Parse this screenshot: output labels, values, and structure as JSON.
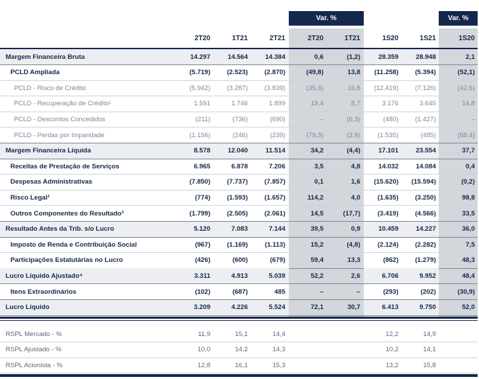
{
  "var_header": "Var. %",
  "var_header_2": "Var. %",
  "columns": [
    "2T20",
    "1T21",
    "2T21",
    "2T20",
    "1T21",
    "1S20",
    "1S21",
    "1S20"
  ],
  "rows": [
    {
      "label": "Margem Financeira Bruta",
      "style": "bold",
      "values": [
        "14.297",
        "14.564",
        "14.384",
        "0,6",
        "(1,2)",
        "28.359",
        "28.948",
        "2,1"
      ]
    },
    {
      "label": "PCLD Ampliada",
      "style": "mid",
      "values": [
        "(5.719)",
        "(2.523)",
        "(2.870)",
        "(49,8)",
        "13,8",
        "(11.258)",
        "(5.394)",
        "(52,1)"
      ]
    },
    {
      "label": "PCLD - Risco de Crédito",
      "style": "light",
      "values": [
        "(5.942)",
        "(3.287)",
        "(3.839)",
        "(35,4)",
        "16,8",
        "(12.419)",
        "(7.126)",
        "(42,6)"
      ]
    },
    {
      "label": "PCLD - Recuperação de Crédito¹",
      "style": "light",
      "values": [
        "1.591",
        "1.746",
        "1.899",
        "19,4",
        "8,7",
        "3.176",
        "3.645",
        "14,8"
      ]
    },
    {
      "label": "PCLD - Descontos Concedidos",
      "style": "light",
      "values": [
        "(211)",
        "(736)",
        "(690)",
        "–",
        "(6,3)",
        "(480)",
        "(1.427)",
        "–"
      ]
    },
    {
      "label": "PCLD - Perdas por Imparidade",
      "style": "light",
      "values": [
        "(1.156)",
        "(246)",
        "(239)",
        "(79,3)",
        "(2,8)",
        "(1.535)",
        "(485)",
        "(68,4)"
      ]
    },
    {
      "label": "Margem Financeira Líquida",
      "style": "bold",
      "values": [
        "8.578",
        "12.040",
        "11.514",
        "34,2",
        "(4,4)",
        "17.101",
        "23.554",
        "37,7"
      ]
    },
    {
      "label": "Receitas de Prestação de Serviços",
      "style": "mid",
      "values": [
        "6.965",
        "6.878",
        "7.206",
        "3,5",
        "4,8",
        "14.032",
        "14.084",
        "0,4"
      ]
    },
    {
      "label": "Despesas Administrativas",
      "style": "mid",
      "values": [
        "(7.850)",
        "(7.737)",
        "(7.857)",
        "0,1",
        "1,6",
        "(15.620)",
        "(15.594)",
        "(0,2)"
      ]
    },
    {
      "label": "Risco Legal²",
      "style": "mid",
      "values": [
        "(774)",
        "(1.593)",
        "(1.657)",
        "114,2",
        "4,0",
        "(1.635)",
        "(3.250)",
        "98,8"
      ]
    },
    {
      "label": "Outros Componentes do Resultado³",
      "style": "mid",
      "values": [
        "(1.799)",
        "(2.505)",
        "(2.061)",
        "14,5",
        "(17,7)",
        "(3.419)",
        "(4.566)",
        "33,5"
      ]
    },
    {
      "label": "Resultado Antes da Trib. s/o Lucro",
      "style": "bold",
      "values": [
        "5.120",
        "7.083",
        "7.144",
        "39,5",
        "0,9",
        "10.459",
        "14.227",
        "36,0"
      ]
    },
    {
      "label": "Imposto de Renda e Contribuição Social",
      "style": "mid",
      "values": [
        "(967)",
        "(1.169)",
        "(1.113)",
        "15,2",
        "(4,8)",
        "(2.124)",
        "(2.282)",
        "7,5"
      ]
    },
    {
      "label": "Participações Estatutárias no Lucro",
      "style": "mid",
      "values": [
        "(426)",
        "(600)",
        "(679)",
        "59,4",
        "13,3",
        "(862)",
        "(1.279)",
        "48,3"
      ]
    },
    {
      "label": "Lucro Líquido Ajustado⁴",
      "style": "bold",
      "values": [
        "3.311",
        "4.913",
        "5.039",
        "52,2",
        "2,6",
        "6.706",
        "9.952",
        "48,4"
      ]
    },
    {
      "label": "Itens Extraordinários",
      "style": "mid",
      "values": [
        "(102)",
        "(687)",
        "485",
        "–",
        "–",
        "(293)",
        "(202)",
        "(30,9)"
      ]
    },
    {
      "label": "Lucro Líquido",
      "style": "bold",
      "values": [
        "3.209",
        "4.226",
        "5.524",
        "72,1",
        "30,7",
        "6.413",
        "9.750",
        "52,0"
      ]
    }
  ],
  "rspl_rows": [
    {
      "label": "RSPL Mercado - %",
      "values": [
        "11,9",
        "15,1",
        "14,4",
        "",
        "",
        "12,2",
        "14,9",
        ""
      ]
    },
    {
      "label": "RSPL Ajustado - %",
      "values": [
        "10,0",
        "14,2",
        "14,3",
        "",
        "",
        "10,2",
        "14,1",
        ""
      ]
    },
    {
      "label": "RSPL Acionista - %",
      "values": [
        "12,8",
        "16,1",
        "15,3",
        "",
        "",
        "13,2",
        "15,8",
        ""
      ]
    }
  ]
}
